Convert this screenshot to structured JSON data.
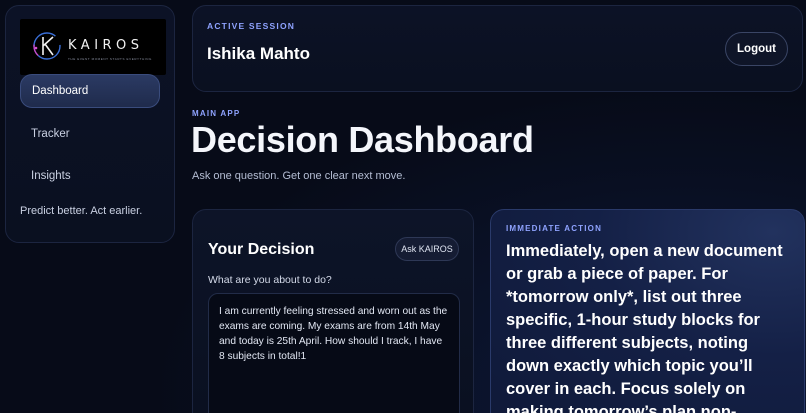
{
  "brand": {
    "name": "KAIROS",
    "tagline_small": "THE EVENT MOMENT STARTS EVERYTHING"
  },
  "sidebar": {
    "items": [
      {
        "label": "Dashboard",
        "active": true
      },
      {
        "label": "Tracker",
        "active": false
      },
      {
        "label": "Insights",
        "active": false
      }
    ],
    "tagline": "Predict better. Act earlier."
  },
  "session": {
    "eyebrow": "ACTIVE SESSION",
    "user_name": "Ishika Mahto",
    "logout_label": "Logout"
  },
  "main": {
    "eyebrow": "MAIN APP",
    "title": "Decision Dashboard",
    "subtitle": "Ask one question. Get one clear next move."
  },
  "decision": {
    "title": "Your Decision",
    "ask_button": "Ask KAIROS",
    "question_label": "What are you about to do?",
    "question_value": "I am currently feeling stressed and worn out as the exams are coming. My exams are from 14th May and today is 25th April. How should I track, I have 8 subjects in total!1"
  },
  "action": {
    "eyebrow": "IMMEDIATE ACTION",
    "text": "Immediately, open a new document or grab a piece of paper. For *tomorrow only*, list out three specific, 1-hour study blocks for three different subjects, noting down exactly which topic you’ll cover in each. Focus solely on making tomorrow’s plan non-"
  },
  "colors": {
    "background": "#070b18",
    "accent": "#8fa3ff",
    "card_border": "#1c2540",
    "active_nav": "#2b3a63",
    "action_card": "#142046"
  }
}
